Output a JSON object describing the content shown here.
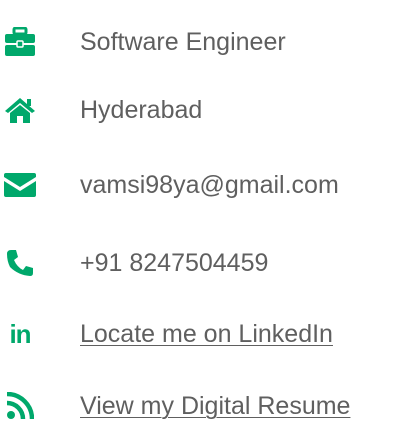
{
  "colors": {
    "icon": "#00a86b",
    "text": "#5f5f5f"
  },
  "contacts": [
    {
      "icon": "briefcase-icon",
      "text": "Software Engineer"
    },
    {
      "icon": "home-icon",
      "text": "Hyderabad"
    },
    {
      "icon": "envelope-icon",
      "text": "vamsi98ya@gmail.com"
    },
    {
      "icon": "phone-icon",
      "text": "+91 8247504459"
    },
    {
      "icon": "linkedin-icon",
      "icon_text": "in",
      "text": "Locate me on LinkedIn"
    },
    {
      "icon": "rss-icon",
      "text": "View my Digital Resume"
    }
  ]
}
